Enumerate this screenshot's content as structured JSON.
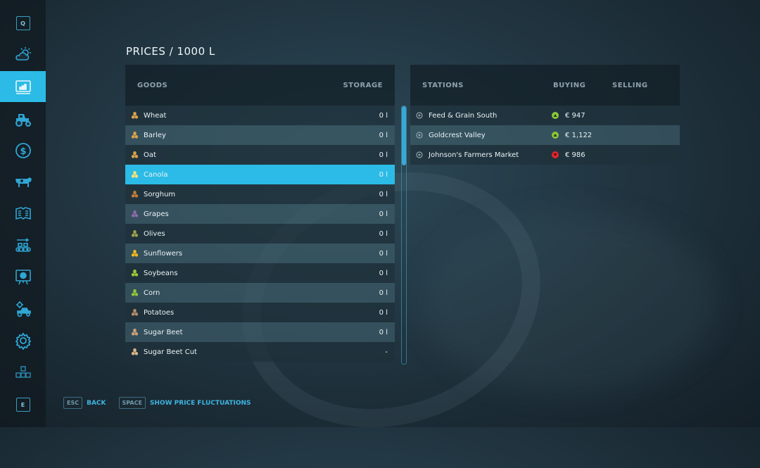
{
  "page_title": "PRICES / 1000 L",
  "sidebar": {
    "active_index": 2,
    "items": [
      {
        "icon": "q-key-icon",
        "key": "Q"
      },
      {
        "icon": "weather-icon"
      },
      {
        "icon": "prices-chart-icon"
      },
      {
        "icon": "tractor-icon"
      },
      {
        "icon": "finances-dollar-icon"
      },
      {
        "icon": "animals-cow-icon"
      },
      {
        "icon": "contracts-icon"
      },
      {
        "icon": "production-conveyor-icon"
      },
      {
        "icon": "statistics-board-icon"
      },
      {
        "icon": "garage-gear-tractor-icon"
      },
      {
        "icon": "settings-gear-icon"
      },
      {
        "icon": "multiplayer-blocks-icon"
      },
      {
        "icon": "e-key-icon",
        "key": "E"
      }
    ]
  },
  "goods_table": {
    "headers": {
      "goods": "GOODS",
      "storage": "STORAGE"
    },
    "selected_index": 3,
    "rows": [
      {
        "name": "Wheat",
        "storage": "0 l",
        "icon": "wheat-icon",
        "color": "#d9a24a"
      },
      {
        "name": "Barley",
        "storage": "0 l",
        "icon": "barley-icon",
        "color": "#d9a24a"
      },
      {
        "name": "Oat",
        "storage": "0 l",
        "icon": "oat-icon",
        "color": "#d9a24a"
      },
      {
        "name": "Canola",
        "storage": "0 l",
        "icon": "canola-icon",
        "color": "#f1e37a"
      },
      {
        "name": "Sorghum",
        "storage": "0 l",
        "icon": "sorghum-icon",
        "color": "#c27a3a"
      },
      {
        "name": "Grapes",
        "storage": "0 l",
        "icon": "grapes-icon",
        "color": "#8a6aa8"
      },
      {
        "name": "Olives",
        "storage": "0 l",
        "icon": "olives-icon",
        "color": "#9aa04a"
      },
      {
        "name": "Sunflowers",
        "storage": "0 l",
        "icon": "sunflower-icon",
        "color": "#f0b820"
      },
      {
        "name": "Soybeans",
        "storage": "0 l",
        "icon": "soybeans-icon",
        "color": "#9bc93a"
      },
      {
        "name": "Corn",
        "storage": "0 l",
        "icon": "corn-icon",
        "color": "#8cc63a"
      },
      {
        "name": "Potatoes",
        "storage": "0 l",
        "icon": "potato-icon",
        "color": "#b08a6a"
      },
      {
        "name": "Sugar Beet",
        "storage": "0 l",
        "icon": "sugar-beet-icon",
        "color": "#c9a07a"
      },
      {
        "name": "Sugar Beet Cut",
        "storage": "-",
        "icon": "sugar-beet-cut-icon",
        "color": "#d9b48a"
      }
    ]
  },
  "stations_table": {
    "headers": {
      "stations": "STATIONS",
      "buying": "BUYING",
      "selling": "SELLING"
    },
    "rows": [
      {
        "name": "Feed & Grain South",
        "trend": "up",
        "trend_color": "#8cc63a",
        "buying": "€ 947",
        "selling": ""
      },
      {
        "name": "Goldcrest Valley",
        "trend": "up",
        "trend_color": "#8cc63a",
        "buying": "€ 1,122",
        "selling": ""
      },
      {
        "name": "Johnson's Farmers Market",
        "trend": "down",
        "trend_color": "#e0262e",
        "buying": "€ 986",
        "selling": ""
      }
    ]
  },
  "scroll": {
    "position_fraction": 0.0,
    "visible_fraction": 0.23
  },
  "footer": {
    "actions": [
      {
        "key": "ESC",
        "label": "BACK"
      },
      {
        "key": "SPACE",
        "label": "SHOW PRICE FLUCTUATIONS"
      }
    ]
  },
  "colors": {
    "accent": "#2bbbe6",
    "up": "#8cc63a",
    "down": "#e0262e"
  }
}
